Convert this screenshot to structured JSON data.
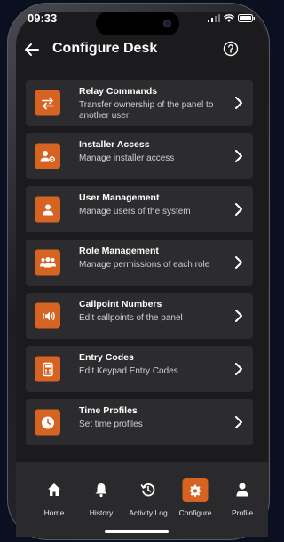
{
  "status_bar": {
    "time": "09:33"
  },
  "header": {
    "title": "Configure Desk"
  },
  "menu": [
    {
      "title": "Relay Commands",
      "subtitle": "Transfer ownership of the panel to another user",
      "icon": "transfer-arrows-icon"
    },
    {
      "title": "Installer Access",
      "subtitle": "Manage installer access",
      "icon": "user-gear-icon"
    },
    {
      "title": "User Management",
      "subtitle": "Manage users of the system",
      "icon": "user-icon"
    },
    {
      "title": "Role Management",
      "subtitle": "Manage permissions of each role",
      "icon": "users-group-icon"
    },
    {
      "title": "Callpoint Numbers",
      "subtitle": "Edit callpoints of the panel",
      "icon": "speaker-icon"
    },
    {
      "title": "Entry Codes",
      "subtitle": "Edit Keypad Entry Codes",
      "icon": "keypad-icon"
    },
    {
      "title": "Time Profiles",
      "subtitle": "Set time profiles",
      "icon": "clock-icon"
    }
  ],
  "bottom_nav": [
    {
      "label": "Home",
      "icon": "home-icon",
      "active": false
    },
    {
      "label": "History",
      "icon": "bell-icon",
      "active": false
    },
    {
      "label": "Activity Log",
      "icon": "history-icon",
      "active": false
    },
    {
      "label": "Configure",
      "icon": "gear-icon",
      "active": true
    },
    {
      "label": "Profile",
      "icon": "profile-icon",
      "active": false
    }
  ],
  "colors": {
    "accent": "#d76322",
    "card": "#2c2c2e",
    "background": "#1b1b1d"
  }
}
